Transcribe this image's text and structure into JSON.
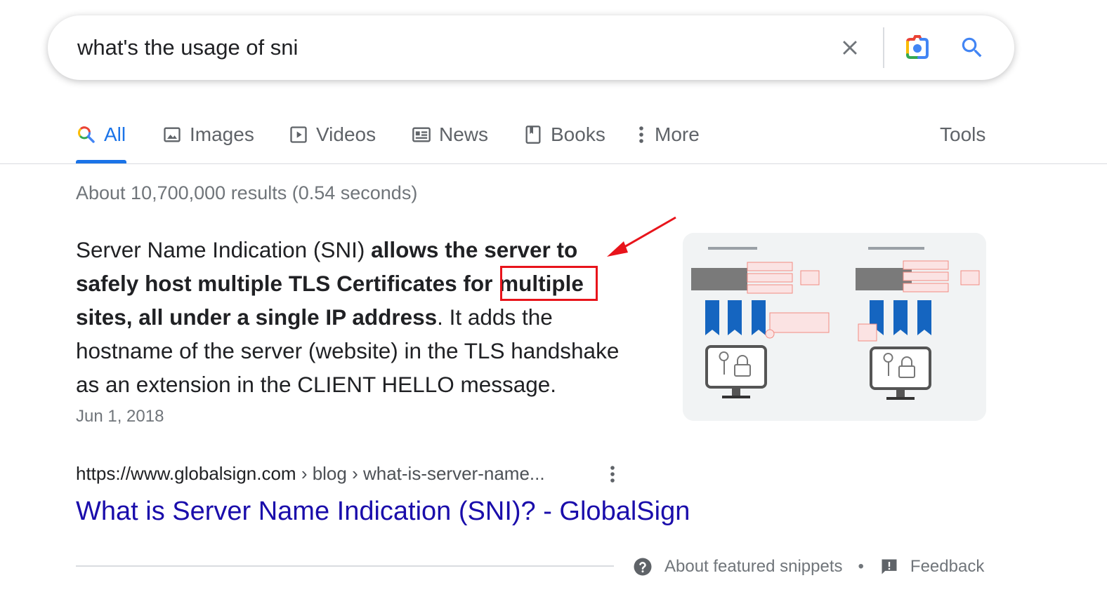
{
  "search": {
    "query": "what's the usage of sni",
    "clear_icon": "close-icon",
    "camera_icon": "camera-icon",
    "search_icon": "search-icon"
  },
  "tabs": [
    {
      "label": "All",
      "icon": "search-icon",
      "active": true
    },
    {
      "label": "Images",
      "icon": "image-icon"
    },
    {
      "label": "Videos",
      "icon": "play-icon"
    },
    {
      "label": "News",
      "icon": "newspaper-icon"
    },
    {
      "label": "Books",
      "icon": "book-icon"
    },
    {
      "label": "More",
      "icon": "more-vert-icon"
    }
  ],
  "tools_label": "Tools",
  "result_stats": "About 10,700,000 results (0.54 seconds)",
  "snippet": {
    "part1": "Server Name Indication (SNI) ",
    "bold1": "allows the server to safely host multiple TLS Certificates for multiple sites, all under a single IP address",
    "part2": ". It adds the hostname of the server (website) in the TLS handshake as an extension in the CLIENT HELLO message.",
    "date": "Jun 1, 2018"
  },
  "result": {
    "url_domain": "https://www.globalsign.com",
    "url_path": " › blog › what-is-server-name...",
    "title": "What is Server Name Indication (SNI)? - GlobalSign"
  },
  "footer": {
    "about_label": "About featured snippets",
    "separator": "•",
    "feedback_label": "Feedback"
  },
  "colors": {
    "accent": "#1a73e8",
    "link": "#1a0dab",
    "annotation": "#e8141b"
  }
}
